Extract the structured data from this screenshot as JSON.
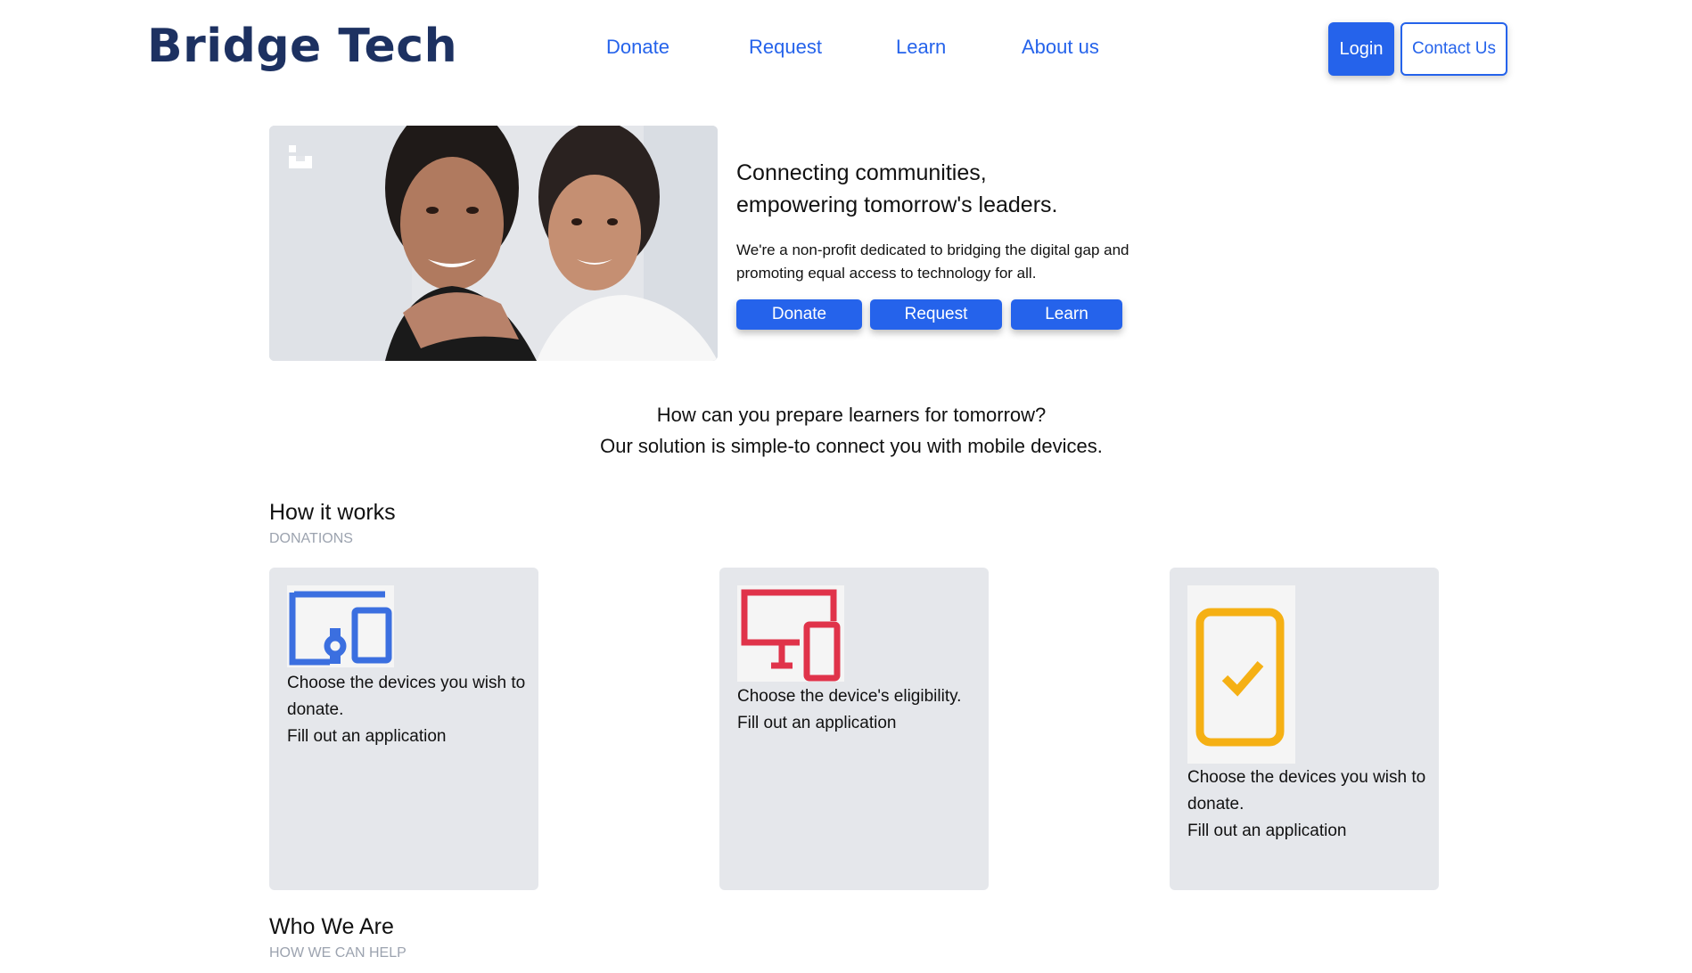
{
  "header": {
    "logo": "Bridge Tech",
    "nav": [
      "Donate",
      "Request",
      "Learn",
      "About us"
    ],
    "login": "Login",
    "contact": "Contact Us"
  },
  "hero": {
    "title_line1": "Connecting communities,",
    "title_line2": "empowering tomorrow's leaders.",
    "subtitle": "We're a non-profit dedicated to bridging the digital gap and promoting equal access to technology for all.",
    "buttons": [
      "Donate",
      "Request",
      "Learn"
    ]
  },
  "tagline": {
    "line1": "How can you prepare learners for tomorrow?",
    "line2": "Our solution is simple-to connect you with mobile devices."
  },
  "how_it_works": {
    "title": "How it works",
    "subtitle": "DONATIONS",
    "cards": [
      {
        "line1": "Choose the devices you wish to donate.",
        "line2": "Fill out an application",
        "icon": "devices-icon",
        "color": "#3b6fe0"
      },
      {
        "line1": "Choose the device's eligibility.",
        "line2": "Fill out an application",
        "icon": "monitor-phone-icon",
        "color": "#e0334a"
      },
      {
        "line1": "Choose the devices you wish to donate.",
        "line2": "Fill out an application",
        "icon": "phone-check-icon",
        "color": "#f5b014"
      }
    ]
  },
  "who_we_are": {
    "title": "Who We Are",
    "subtitle": "HOW WE CAN HELP"
  },
  "colors": {
    "primary": "#2563eb",
    "logo": "#1d3161",
    "card_bg": "#e5e7eb"
  }
}
